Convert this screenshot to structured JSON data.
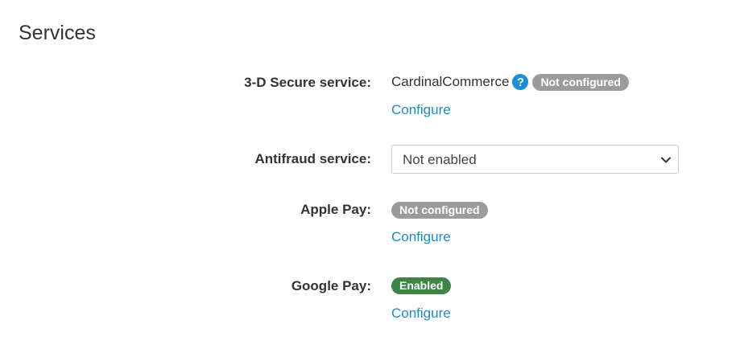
{
  "section": {
    "title": "Services"
  },
  "three_d_secure": {
    "label": "3-D Secure service:",
    "provider": "CardinalCommerce",
    "help_glyph": "?",
    "status": "Not configured",
    "link": "Configure"
  },
  "antifraud": {
    "label": "Antifraud service:",
    "selected": "Not enabled"
  },
  "apple_pay": {
    "label": "Apple Pay:",
    "status": "Not configured",
    "link": "Configure"
  },
  "google_pay": {
    "label": "Google Pay:",
    "status": "Enabled",
    "link": "Configure"
  },
  "colors": {
    "link": "#1a8bc9",
    "help_icon": "#1a8fd6",
    "badge_not_configured": "#9b9b9b",
    "badge_enabled": "#3e8447"
  },
  "icons": {
    "help": "help-icon",
    "dropdown": "chevron-down-icon"
  }
}
